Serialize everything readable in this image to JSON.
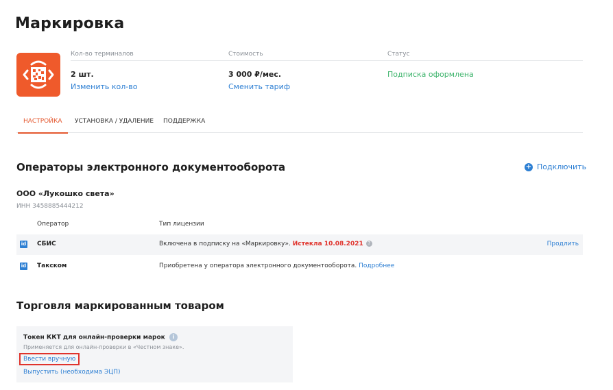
{
  "page": {
    "title": "Маркировка"
  },
  "summary": {
    "terminals": {
      "label": "Кол-во терминалов",
      "value": "2 шт.",
      "action": "Изменить кол-во"
    },
    "cost": {
      "label": "Стоимость",
      "value": "3 000 ₽/мес.",
      "action": "Сменить тариф"
    },
    "status": {
      "label": "Статус",
      "value": "Подписка оформлена",
      "color": "#3bb36a"
    }
  },
  "tabs": [
    {
      "label": "НАСТРОЙКА",
      "active": true
    },
    {
      "label": "УСТАНОВКА / УДАЛЕНИЕ",
      "active": false
    },
    {
      "label": "ПОДДЕРЖКА",
      "active": false
    }
  ],
  "edo": {
    "title": "Операторы электронного документооборота",
    "connect_label": "Подключить",
    "company": "ООО «Лукошко света»",
    "inn": "ИНН 3458885444212",
    "columns": {
      "operator": "Оператор",
      "license": "Тип лицензии"
    },
    "rows": [
      {
        "badge": "id",
        "operator": "СБИС",
        "license": "Включена в подписку на «Маркировку».",
        "expired": "Истекла 10.08.2021",
        "help_icon": "question-icon",
        "action": "Продлить"
      },
      {
        "badge": "id",
        "operator": "Такском",
        "license": "Приобретена у оператора электронного документооборота.",
        "more": "Подробнее"
      }
    ]
  },
  "trade": {
    "title": "Торговля маркированным товаром",
    "token": {
      "title": "Токен ККТ для онлайн-проверки марок",
      "info_icon": "i",
      "description": "Применяется для онлайн-проверки в «Честном знаке».",
      "manual_label": "Ввести вручную",
      "issue_label": "Выпустить (необходима ЭЦП)"
    }
  },
  "colors": {
    "accent": "#e4572e",
    "link": "#2d7fd3",
    "logo_bg": "#ef5a2b",
    "error": "#e0332c"
  }
}
